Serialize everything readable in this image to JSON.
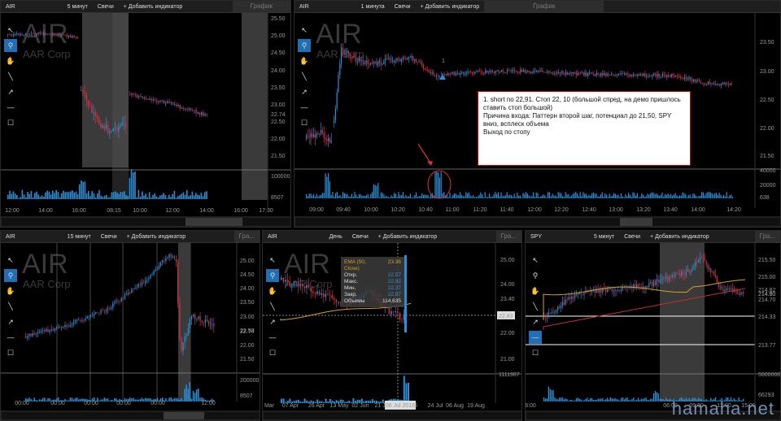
{
  "panels": [
    {
      "id": "p1",
      "symbol": "AIR",
      "interval": "5 минут",
      "chart_type": "Свечи",
      "add_indicator": "+ Добавить индикатор",
      "tab": "График",
      "watermark": "AIR",
      "watermark_sub": "AAR Corp",
      "y_ticks": [
        "25.50",
        "25.00",
        "24.50",
        "24.00",
        "23.50",
        "23.00",
        "22.50",
        "22.00",
        "21.50"
      ],
      "last_price": "22.74",
      "vol_tick": "100000",
      "vol_last": "8507",
      "x_ticks": [
        "12:00",
        "14:00",
        "16:00",
        "08:15",
        "10:00",
        "12:00",
        "14:00",
        "16:00",
        "17:30"
      ]
    },
    {
      "id": "p2",
      "symbol": "AIR",
      "interval": "1 минута",
      "chart_type": "Свечи",
      "add_indicator": "+ Добавить индикатор",
      "tab": "График",
      "watermark": "AIR",
      "watermark_sub": "AAR Corp",
      "y_ticks": [
        "23.50",
        "23.00",
        "22.50",
        "22.00",
        "21.50"
      ],
      "vol_ticks": [
        "40000",
        "20000"
      ],
      "vol_last": "638",
      "marker": "1",
      "x_ticks": [
        "09:00",
        "09:40",
        "10:00",
        "10:20",
        "10:40",
        "11:00",
        "11:20",
        "11:40",
        "12:00",
        "12:20",
        "12:40",
        "13:00",
        "13:20",
        "13:40",
        "14:00",
        "14:20"
      ]
    },
    {
      "id": "p3",
      "symbol": "AIR",
      "interval": "15 минут",
      "chart_type": "Свечи",
      "add_indicator": "+ Добавить индикатор",
      "tab": "Гра...",
      "watermark": "AIR",
      "watermark_sub": "AAR Corp",
      "y_ticks": [
        "25.00",
        "24.50",
        "24.00",
        "23.50",
        "23.00",
        "22.50",
        "22.00",
        "21.50"
      ],
      "last_price": "22.74",
      "vol_tick": "200000",
      "vol_last": "8507",
      "x_ticks": [
        "00:00",
        "00:00",
        "00:00",
        "00:00",
        "00:00",
        "12:00"
      ]
    },
    {
      "id": "p4",
      "symbol": "AIR",
      "interval": "День",
      "chart_type": "Свечи",
      "add_indicator": "+ Добавить индикатор",
      "tab": "Гра...",
      "watermark": "AIR",
      "watermark_sub": "AAR Corp",
      "y_ticks": [
        "25.00",
        "24.00",
        "23.40",
        "22.00",
        "21.00"
      ],
      "crosshair_price": "22.83",
      "vol_tick": "1111987",
      "x_ticks": [
        "Mar",
        "07 Apr",
        "26 Apr",
        "13 May",
        "02 Jun",
        "21 Jun",
        "06 Jul 2016",
        "24 Jul",
        "06 Aug",
        "19 Aug"
      ],
      "tooltip": {
        "ema_label": "EMA (50, Close)",
        "ema_value": "23.36",
        "rows": [
          {
            "label": "Откр.",
            "value": "22.57"
          },
          {
            "label": "Макс.",
            "value": "22.92"
          },
          {
            "label": "Мин.",
            "value": "22.37"
          },
          {
            "label": "Закр.",
            "value": "22.87"
          }
        ],
        "vol_label": "Объемы",
        "vol_value": "114,635"
      }
    },
    {
      "id": "p5",
      "symbol": "SPY",
      "interval": "5 минут",
      "chart_type": "Свечи",
      "add_indicator": "+ Добавить индикатор",
      "tab": "Гра...",
      "y_ticks": [
        "215.50",
        "215.00",
        "214.50",
        "214.33",
        "213.77"
      ],
      "price_red": "214.82",
      "price_orange": "214.80",
      "price_blue": "214.70",
      "level1": "214.33",
      "level2": "213.77",
      "vol_tick": "5000000",
      "vol_last": "66293",
      "x_ticks": [
        "6:00",
        "06:00",
        "09:00",
        "12:00",
        "15:00"
      ]
    }
  ],
  "note": {
    "line1": "1. short по 22,91. Стоп 22, 10 (большой спред, на демо пришлось ставить стоп большой)",
    "line2": "Причина входа: Паттерн второй шаг, потенциал до 21,50, SPY вниз, всплеск объема",
    "line3": "Выход по стопу"
  },
  "site": "hamaha.net",
  "colors": {
    "up": "#2b8fd6",
    "down": "#d43040",
    "ema": "#d4a020",
    "ema_red": "#c03030",
    "session": "#3a3a3a"
  }
}
